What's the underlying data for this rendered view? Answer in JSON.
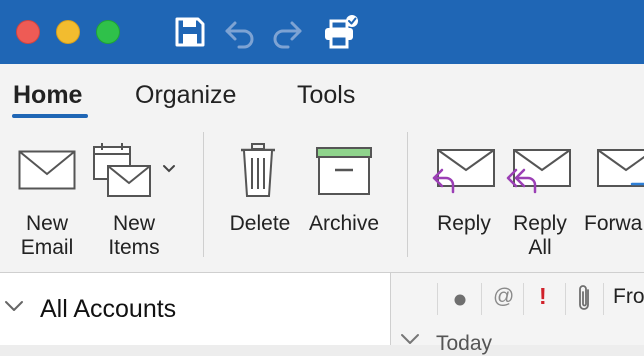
{
  "window": {
    "colors": {
      "titlebar": "#1f66b5",
      "accent": "#1f66b5",
      "reply_arrow": "#9b3fb5",
      "archive_lid": "#8fd48c"
    }
  },
  "toolbar": {
    "icons": [
      "save-icon",
      "undo-icon",
      "redo-icon",
      "sync-icon"
    ]
  },
  "tabs": [
    {
      "label": "Home",
      "active": true
    },
    {
      "label": "Organize",
      "active": false
    },
    {
      "label": "Tools",
      "active": false
    }
  ],
  "ribbon": {
    "new_email": {
      "line1": "New",
      "line2": "Email"
    },
    "new_items": {
      "line1": "New",
      "line2": "Items"
    },
    "delete": {
      "label": "Delete"
    },
    "archive": {
      "label": "Archive"
    },
    "reply": {
      "label": "Reply"
    },
    "reply_all": {
      "line1": "Reply",
      "line2": "All"
    },
    "forward": {
      "label": "Forwa"
    }
  },
  "folders": {
    "accounts_label": "All Accounts"
  },
  "message_list": {
    "columns": {
      "at": "@",
      "importance": "!",
      "from": "Fro"
    },
    "group_header": "Today"
  }
}
